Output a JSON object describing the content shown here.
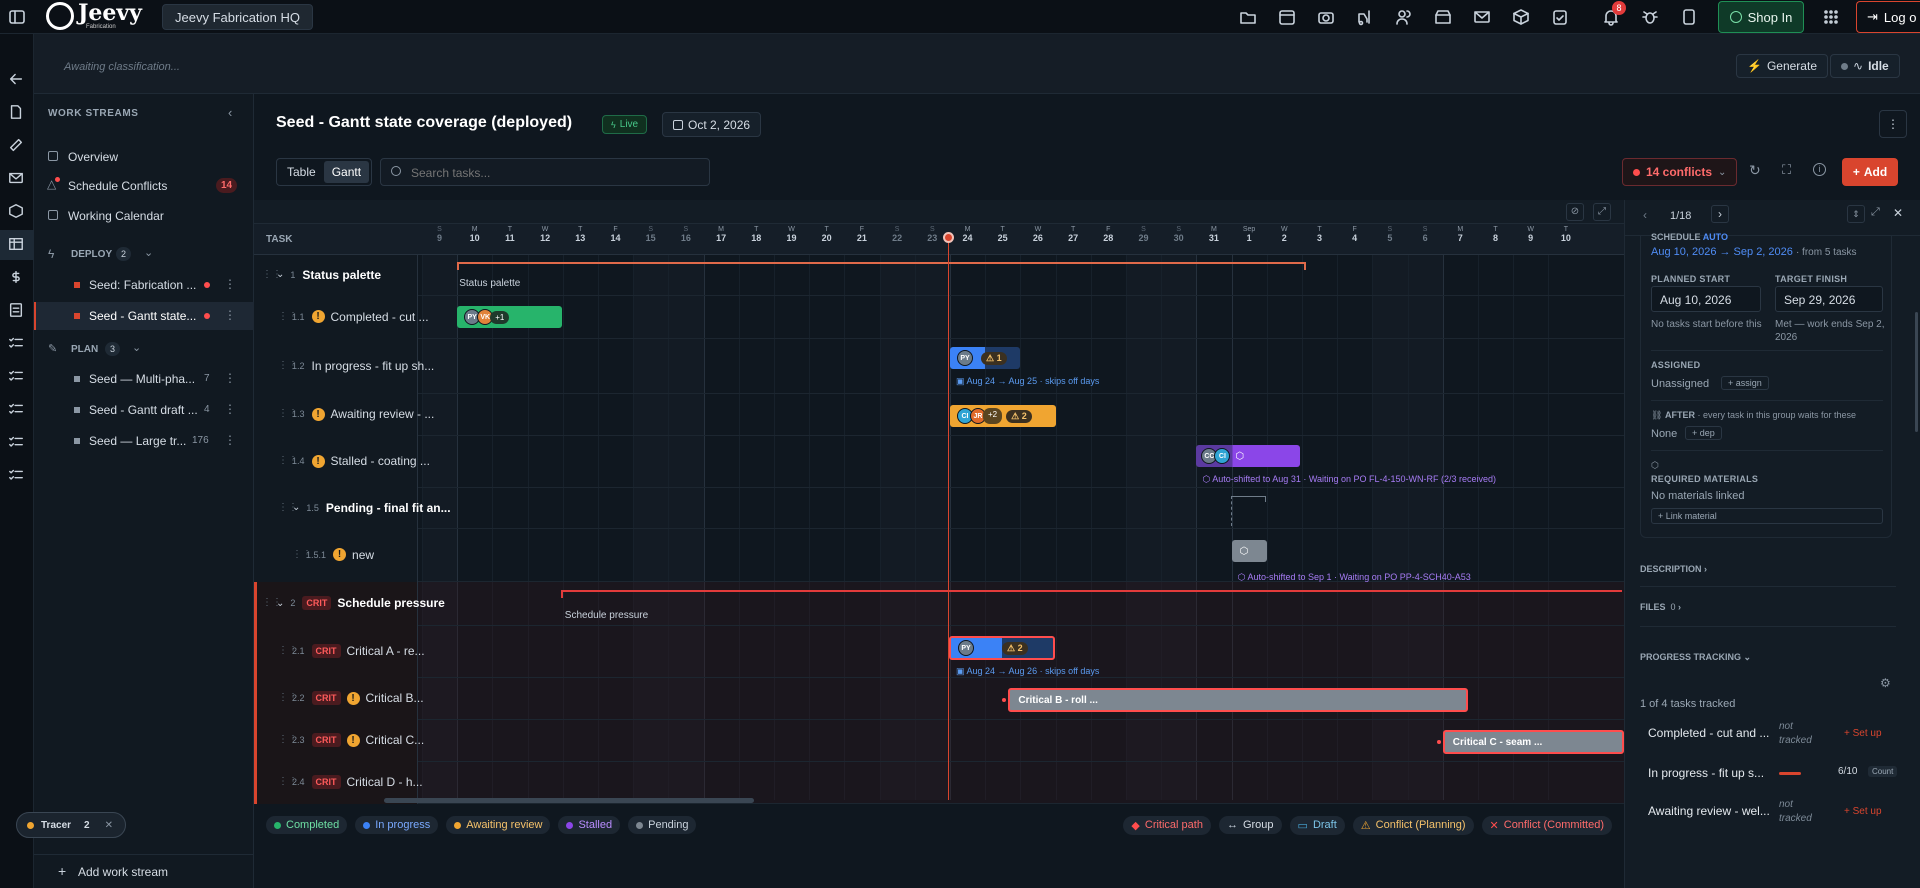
{
  "app": {
    "logo": "Jeevy",
    "logo_sub": "Fabrication",
    "workspace": "Jeevy Fabrication HQ",
    "notif_count": "8",
    "shop_in": "Shop In",
    "logout": "Log o"
  },
  "subbar": {
    "status_text": "Awaiting classification...",
    "generate": "Generate",
    "idle": "Idle"
  },
  "sidebar": {
    "title": "WORK STREAMS",
    "overview": "Overview",
    "conflicts": "Schedule Conflicts",
    "conflicts_count": "14",
    "calendar": "Working Calendar",
    "deploy": {
      "label": "DEPLOY",
      "count": "2",
      "items": [
        {
          "label": "Seed: Fabrication ...",
          "active": false
        },
        {
          "label": "Seed - Gantt state...",
          "active": true
        }
      ]
    },
    "plan": {
      "label": "PLAN",
      "count": "3",
      "items": [
        {
          "label": "Seed — Multi-pha...",
          "count": "7"
        },
        {
          "label": "Seed - Gantt draft ...",
          "count": "4"
        },
        {
          "label": "Seed — Large tr...",
          "count": "176"
        }
      ]
    },
    "add_stream": "Add work stream",
    "tracer": "Tracer",
    "tracer_count": "2"
  },
  "header": {
    "title": "Seed - Gantt state coverage (deployed)",
    "live": "Live",
    "date": "Oct 2, 2026",
    "view_table": "Table",
    "view_gantt": "Gantt",
    "search_placeholder": "Search tasks...",
    "conflicts": "14 conflicts",
    "add": "Add"
  },
  "gantt": {
    "task_header": "TASK",
    "days": [
      {
        "w": "S",
        "d": "9"
      },
      {
        "w": "M",
        "d": "10"
      },
      {
        "w": "T",
        "d": "11"
      },
      {
        "w": "W",
        "d": "12"
      },
      {
        "w": "T",
        "d": "13"
      },
      {
        "w": "F",
        "d": "14"
      },
      {
        "w": "S",
        "d": "15"
      },
      {
        "w": "S",
        "d": "16"
      },
      {
        "w": "M",
        "d": "17"
      },
      {
        "w": "T",
        "d": "18"
      },
      {
        "w": "W",
        "d": "19"
      },
      {
        "w": "T",
        "d": "20"
      },
      {
        "w": "F",
        "d": "21"
      },
      {
        "w": "S",
        "d": "22"
      },
      {
        "w": "S",
        "d": "23"
      },
      {
        "w": "M",
        "d": "24"
      },
      {
        "w": "T",
        "d": "25"
      },
      {
        "w": "W",
        "d": "26"
      },
      {
        "w": "T",
        "d": "27"
      },
      {
        "w": "F",
        "d": "28"
      },
      {
        "w": "S",
        "d": "29"
      },
      {
        "w": "S",
        "d": "30"
      },
      {
        "w": "M",
        "d": "31"
      },
      {
        "w": "Sep",
        "d": "1"
      },
      {
        "w": "W",
        "d": "2"
      },
      {
        "w": "T",
        "d": "3"
      },
      {
        "w": "F",
        "d": "4"
      },
      {
        "w": "S",
        "d": "5"
      },
      {
        "w": "S",
        "d": "6"
      },
      {
        "w": "M",
        "d": "7"
      },
      {
        "w": "T",
        "d": "8"
      },
      {
        "w": "W",
        "d": "9"
      },
      {
        "w": "T",
        "d": "10"
      }
    ],
    "rows": [
      {
        "num": "1",
        "label": "Status palette",
        "bold": true
      },
      {
        "num": "1.1",
        "label": "Completed - cut ...",
        "warn": true
      },
      {
        "num": "1.2",
        "label": "In progress - fit up sh...",
        "warn": false
      },
      {
        "num": "1.3",
        "label": "Awaiting review - ...",
        "warn": true
      },
      {
        "num": "1.4",
        "label": "Stalled - coating ...",
        "warn": true
      },
      {
        "num": "1.5",
        "label": "Pending - final fit an...",
        "bold": true
      },
      {
        "num": "1.5.1",
        "label": "new",
        "warn": true
      },
      {
        "num": "2",
        "label": "Schedule pressure",
        "bold": true,
        "crit": "CRIT"
      },
      {
        "num": "2.1",
        "label": "Critical A - re...",
        "crit": "CRIT"
      },
      {
        "num": "2.2",
        "label": "Critical B...",
        "crit": "CRIT",
        "warn": true
      },
      {
        "num": "2.3",
        "label": "Critical C...",
        "crit": "CRIT",
        "warn": true
      },
      {
        "num": "2.4",
        "label": "Critical D - h...",
        "crit": "CRIT"
      }
    ],
    "bars": {
      "status_palette": "Status palette",
      "row11_more": "+1",
      "row12_count": "1",
      "row12_note": "Aug 24 → Aug 25 · skips off days",
      "row13_more": "+2",
      "row13_count": "2",
      "row14_note": "Auto-shifted to Aug 31 · Waiting on PO FL-4-150-WN-RF (2/3 received)",
      "row151_note": "Auto-shifted to Sep 1 · Waiting on PO PP-4-SCH40-A53",
      "schedule_pressure": "Schedule pressure",
      "row21_count": "2",
      "row21_note": "Aug 24 → Aug 26 · skips off days",
      "row22_label": "Critical B - roll ...",
      "row23_label": "Critical C - seam ..."
    },
    "avatars": {
      "py": "PY",
      "vk": "VK",
      "ci": "CI",
      "jr": "JR",
      "cc": "CC"
    }
  },
  "legend": {
    "completed": "Completed",
    "in_progress": "In progress",
    "awaiting": "Awaiting review",
    "stalled": "Stalled",
    "pending": "Pending",
    "critical": "Critical path",
    "group": "Group",
    "draft": "Draft",
    "conflict_plan": "Conflict (Planning)",
    "conflict_commit": "Conflict (Committed)"
  },
  "panel": {
    "pager": "1/18",
    "schedule_label": "SCHEDULE",
    "schedule_mode": "AUTO",
    "range": "Aug 10, 2026 → Sep 2, 2026",
    "range_from": "· from 5 tasks",
    "planned_start_lbl": "PLANNED START",
    "planned_start": "Aug 10, 2026",
    "target_finish_lbl": "TARGET FINISH",
    "target_finish": "Sep 29, 2026",
    "start_note": "No tasks start before this",
    "finish_note": "Met — work ends Sep 2, 2026",
    "assigned_lbl": "ASSIGNED",
    "assigned_val": "Unassigned",
    "assign": "assign",
    "after_lbl": "AFTER",
    "after_note": "· every task in this group waits for these",
    "after_val": "None",
    "dep": "dep",
    "materials_lbl": "REQUIRED MATERIALS",
    "materials_val": "No materials linked",
    "link_material": "+ Link material",
    "description": "DESCRIPTION",
    "files": "FILES",
    "files_count": "0",
    "progress": "PROGRESS TRACKING",
    "tracked": "1 of 4 tasks tracked",
    "track_items": [
      {
        "label": "Completed - cut and ...",
        "status": "not tracked",
        "action": "+ Set up"
      },
      {
        "label": "In progress - fit up s...",
        "status": "6/10",
        "action": "Count"
      },
      {
        "label": "Awaiting review - wel...",
        "status": "not tracked",
        "action": "+ Set up"
      }
    ]
  },
  "colors": {
    "completed": "#27b46b",
    "in_progress": "#3b82f6",
    "awaiting": "#f0a531",
    "stalled": "#8b46e8",
    "pending": "#7d8791",
    "critical": "#ff4d4d",
    "accent_green": "#1f8f55",
    "add_btn": "#d9452e"
  }
}
